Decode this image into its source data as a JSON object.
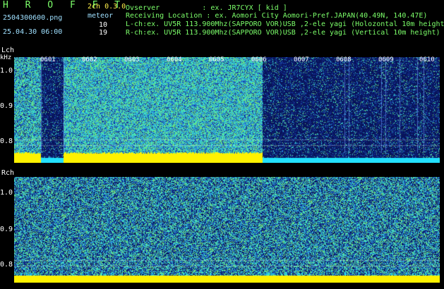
{
  "header": {
    "app_title": "H R O F F T",
    "file_name": "2504300600.png",
    "datetime": "25.04.30 06:00",
    "channel_label": "2ch 0.3.0",
    "meteor_label": "meteor",
    "meteor_lch": "10",
    "meteor_rch": "19",
    "observer_line": "Ovserver          : ex. JR7CYX [ kid ]",
    "location_line": "Receiving Location : ex. Aomori City Aomori-Pref.JAPAN(40.49N, 140.47E)",
    "lch_line": "L-ch:ex. UV5R 113.900Mhz(SAPPORO VOR)USB ,2-ele yagi (Holozontal 10m height)",
    "rch_line": "R-ch:ex. UV5R 113.900Mhz(SAPPORO VOR)USB ,2-ele yagi (Vertical 10m height)"
  },
  "lch": {
    "label": "Lch",
    "unit": "kHz",
    "yticks": [
      "1.0",
      "0.9",
      "0.8"
    ],
    "minutes": [
      "0601",
      "0602",
      "0603",
      "0604",
      "0605",
      "0606",
      "0607",
      "0608",
      "0609",
      "0610"
    ]
  },
  "rch": {
    "label": "Rch",
    "yticks": [
      "1.0",
      "0.9",
      "0.8"
    ]
  },
  "colors": {
    "accent_green": "#7CFF6A",
    "noise_low": "#0A1E6E",
    "noise_high": "#38E0C0",
    "baseline": "#FFF200",
    "baseline_low": "#22E0FF"
  }
}
